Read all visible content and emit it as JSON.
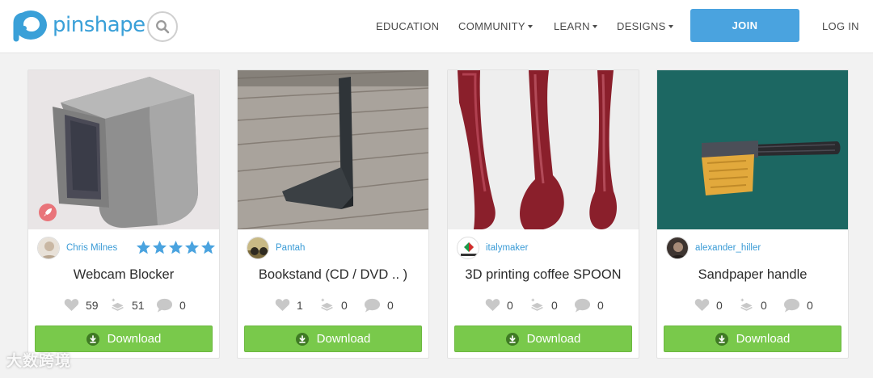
{
  "brand": {
    "name": "pinshape",
    "accent": "#3aa0d8"
  },
  "header": {
    "nav": [
      {
        "label": "EDUCATION",
        "dropdown": false
      },
      {
        "label": "COMMUNITY",
        "dropdown": true
      },
      {
        "label": "LEARN",
        "dropdown": true
      },
      {
        "label": "DESIGNS",
        "dropdown": true
      }
    ],
    "join_label": "JOIN",
    "login_label": "LOG IN",
    "search_icon": "search-icon"
  },
  "cards": [
    {
      "author": "Chris Milnes",
      "title": "Webcam Blocker",
      "likes": "59",
      "makes": "51",
      "comments": "0",
      "rating_stars": 5,
      "featured_badge": "rocket-icon",
      "download_label": "Download"
    },
    {
      "author": "Pantah",
      "title": "Bookstand (CD / DVD .. )",
      "likes": "1",
      "makes": "0",
      "comments": "0",
      "download_label": "Download"
    },
    {
      "author": "italymaker",
      "title": "3D printing coffee SPOON",
      "likes": "0",
      "makes": "0",
      "comments": "0",
      "download_label": "Download"
    },
    {
      "author": "alexander_hiller",
      "title": "Sandpaper handle",
      "likes": "0",
      "makes": "0",
      "comments": "0",
      "download_label": "Download"
    }
  ],
  "watermark": "大数跨境",
  "colors": {
    "join": "#4aa3df",
    "download": "#79c94b",
    "star": "#4aa3df",
    "link": "#3a9bd6"
  }
}
